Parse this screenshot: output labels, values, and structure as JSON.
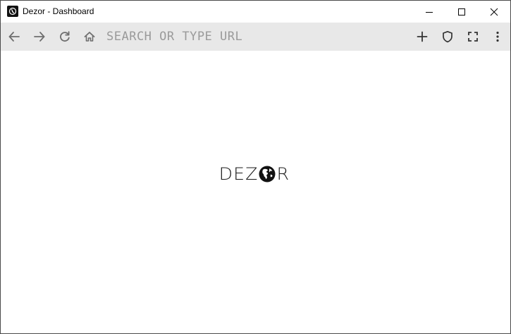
{
  "window": {
    "title": "Dezor - Dashboard"
  },
  "toolbar": {
    "url_placeholder": "SEARCH OR TYPE URL",
    "url_value": ""
  },
  "content": {
    "logo_before": "DEZ",
    "logo_after": "R"
  },
  "icons": {
    "app": "dezor-app-icon",
    "minimize": "minimize-icon",
    "maximize": "maximize-icon",
    "close": "close-icon",
    "back": "arrow-left-icon",
    "forward": "arrow-right-icon",
    "reload": "reload-icon",
    "home": "home-icon",
    "new_tab": "plus-icon",
    "shield": "shield-icon",
    "fullscreen": "fullscreen-icon",
    "menu": "kebab-menu-icon",
    "globe": "globe-icon"
  }
}
